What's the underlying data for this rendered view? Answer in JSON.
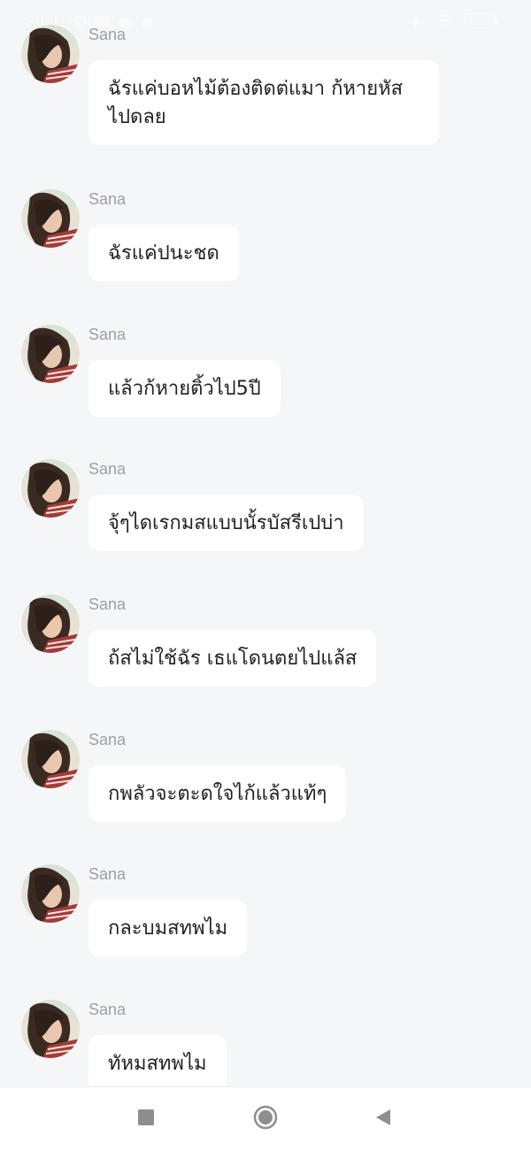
{
  "status_bar": {
    "time": "20:41",
    "battery": "100"
  },
  "messages": [
    {
      "sender": "Sana",
      "text": "ฉัรแค่บอหไม้ต้องติดต่แมา ก้หายหัสไปดลย"
    },
    {
      "sender": "Sana",
      "text": "ฉัรแค่ปนะชด"
    },
    {
      "sender": "Sana",
      "text": "แล้วก้หายติ้วไป5ปี"
    },
    {
      "sender": "Sana",
      "text": "จุ้ๆไดเรกมสแบบนั้รบัสรีเปบ่า"
    },
    {
      "sender": "Sana",
      "text": "ถ้สไม่ใช้ฉัร เธแโดนตยไปแล้ส"
    },
    {
      "sender": "Sana",
      "text": "กพลัวจะตะดใจไก้แล้วแท้ๆ"
    },
    {
      "sender": "Sana",
      "text": "กละบมสทพไม"
    },
    {
      "sender": "Sana",
      "text": "ทัหมสทพไม"
    }
  ],
  "icons": {
    "avatar": "avatar-photo",
    "nav_recent": "square-icon",
    "nav_home": "circle-icon",
    "nav_back": "back-triangle-icon"
  },
  "colors": {
    "background": "#f5f6f8",
    "bubble": "#ffffff",
    "sender_name": "#9aa0a6",
    "nav_icon": "#8e8e8e"
  }
}
